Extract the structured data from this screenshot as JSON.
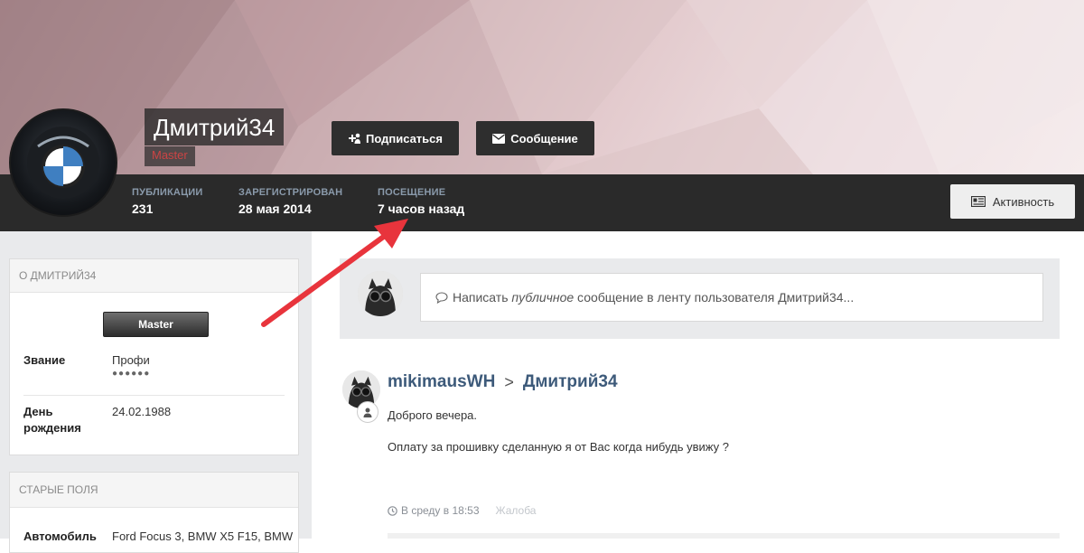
{
  "profile": {
    "username": "Дмитрий34",
    "group": "Master",
    "buttons": {
      "follow": "Подписаться",
      "message": "Сообщение",
      "activity": "Активность"
    },
    "stats": [
      {
        "label": "Публикации",
        "value": "231"
      },
      {
        "label": "Зарегистрирован",
        "value": "28 мая 2014"
      },
      {
        "label": "Посещение",
        "value": "7 часов назад"
      }
    ]
  },
  "sidebar": {
    "about": {
      "title": "О Дмитрий34",
      "badge": "Master",
      "fields": [
        {
          "label": "Звание",
          "value": "Профи",
          "pips": "●●●●●●"
        },
        {
          "label": "День рождения",
          "value": "24.02.1988"
        }
      ]
    },
    "old_fields": {
      "title": "Старые поля",
      "fields": [
        {
          "label": "Автомобиль",
          "value": "Ford Focus 3, BMW X5 F15, BMW"
        }
      ]
    }
  },
  "composer": {
    "prefix": "Написать ",
    "emphasis": "публичное",
    "suffix": " сообщение в ленту пользователя Дмитрий34..."
  },
  "post": {
    "author": "mikimausWH",
    "separator": ">",
    "target": "Дмитрий34",
    "lines": [
      "Доброго вечера.",
      "Оплату за прошивку сделанную я от Вас когда нибудь увижу ?"
    ],
    "time": "В среду в 18:53",
    "report": "Жалоба"
  },
  "colors": {
    "statsbar": "#2a2a2a",
    "link": "#3d5a7a",
    "annotation_arrow": "#e8343c"
  }
}
